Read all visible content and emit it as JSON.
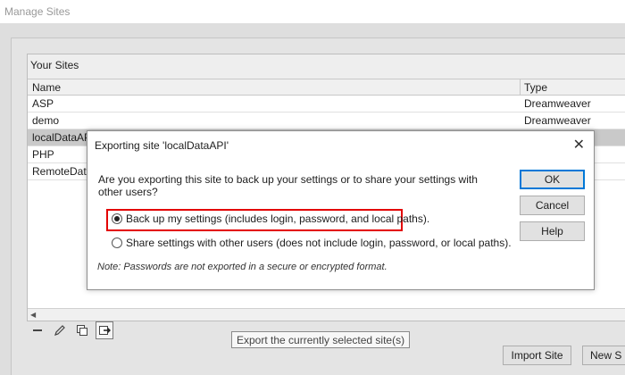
{
  "window": {
    "title": "Manage Sites"
  },
  "sites": {
    "label": "Your Sites",
    "columns": {
      "name": "Name",
      "type": "Type"
    },
    "rows": [
      {
        "name": "ASP",
        "type": "Dreamweaver"
      },
      {
        "name": "demo",
        "type": "Dreamweaver"
      },
      {
        "name": "localDataAPI",
        "type": ""
      },
      {
        "name": "PHP",
        "type": ""
      },
      {
        "name": "RemoteData",
        "type": ""
      }
    ]
  },
  "toolbar": {
    "tooltip": "Export the currently selected site(s)",
    "icons": [
      "minus-icon",
      "pencil-icon",
      "duplicate-icon",
      "export-icon"
    ]
  },
  "footer": {
    "import_label": "Import Site",
    "new_label": "New S"
  },
  "dialog": {
    "title": "Exporting site 'localDataAPI'",
    "question": "Are you exporting this site to back up your settings or to share your settings with other users?",
    "option_backup": "Back up my settings (includes login, password, and local paths).",
    "option_share": "Share settings with other users (does not include login, password, or local paths).",
    "note": "Note: Passwords are not exported in a secure or encrypted format.",
    "ok_label": "OK",
    "cancel_label": "Cancel",
    "help_label": "Help",
    "highlight_color": "#e30000"
  }
}
